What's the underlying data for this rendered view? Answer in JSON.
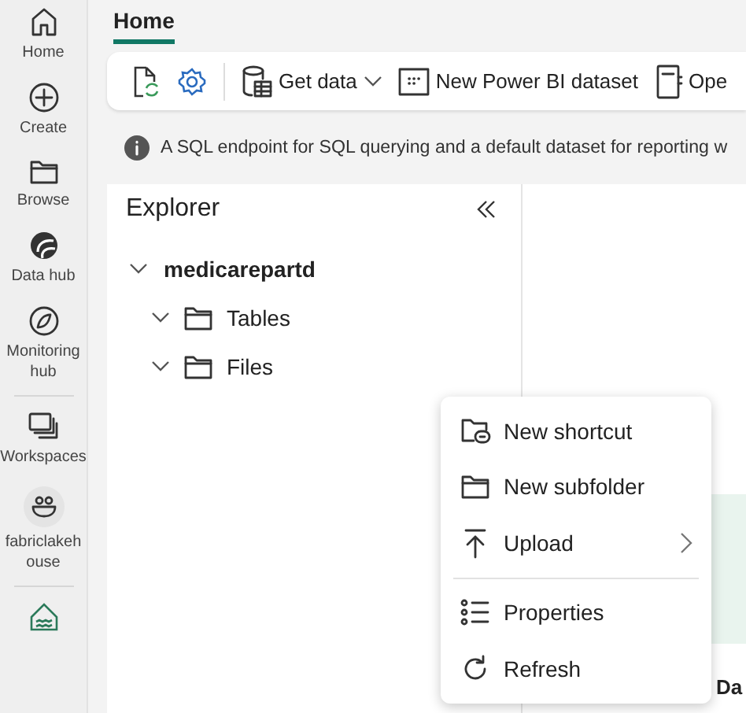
{
  "nav_groups": [
    [
      {
        "kind": "item",
        "label": "Home"
      },
      {
        "kind": "item",
        "label": "Create"
      },
      {
        "kind": "item",
        "label": "Browse"
      },
      {
        "kind": "item",
        "label": "Data hub"
      },
      {
        "kind": "item",
        "label": "Monitoring hub"
      }
    ],
    [
      {
        "kind": "item",
        "label": "Workspaces"
      },
      {
        "kind": "item",
        "label": "fabriclakehouse"
      }
    ],
    [
      {
        "kind": "icon"
      }
    ]
  ],
  "tabs": [
    {
      "label": "Home",
      "selected": true
    }
  ],
  "toolbar": [
    {
      "kind": "icon"
    },
    {
      "kind": "icon"
    },
    {
      "kind": "separator"
    },
    {
      "kind": "button",
      "label": "Get data",
      "dropdown": true
    },
    {
      "kind": "button",
      "label": "New Power BI dataset",
      "dropdown": false
    },
    {
      "kind": "button",
      "label": "Ope",
      "dropdown": false
    }
  ],
  "info": "A SQL endpoint for SQL querying and a default dataset for reporting w",
  "explorer": {
    "title": "Explorer",
    "tree": [
      {
        "label": "medicarepartd",
        "expanded": true,
        "children": [
          {
            "label": "Tables",
            "expanded": true
          },
          {
            "label": "Files",
            "expanded": true
          }
        ]
      }
    ]
  },
  "right_pane": {
    "heading": "Da"
  },
  "menu": {
    "groups": [
      [
        {
          "label": "New shortcut",
          "submenu": false
        },
        {
          "label": "New subfolder",
          "submenu": false
        },
        {
          "label": "Upload",
          "submenu": true
        }
      ],
      [
        {
          "label": "Properties",
          "submenu": false
        },
        {
          "label": "Refresh",
          "submenu": false
        }
      ]
    ]
  }
}
